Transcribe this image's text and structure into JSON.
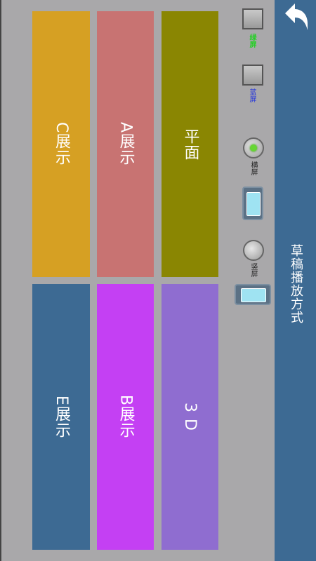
{
  "sidebar": {
    "title": "草稿播放方式",
    "back_icon": "back-arrow-icon",
    "color": "#3d6a93"
  },
  "tiles": {
    "c_display": {
      "label": "C展示",
      "color": "#d6a023"
    },
    "a_display": {
      "label": "A展示",
      "color": "#c87372"
    },
    "flat": {
      "label": "平面",
      "color": "#8a8602"
    },
    "e_display": {
      "label": "E展示",
      "color": "#3d6a93"
    },
    "b_display": {
      "label": "B展示",
      "color": "#c440f3"
    },
    "three_d": {
      "label": "3 D",
      "color": "#8f6dd0"
    }
  },
  "options": {
    "green_screen": {
      "label": "绿屏",
      "color": "#22d022",
      "checked": false
    },
    "blue_screen": {
      "label": "蓝屏",
      "color": "#2233dd",
      "checked": false
    },
    "landscape": {
      "label": "横屏",
      "selected": true
    },
    "portrait": {
      "label": "竖屏",
      "selected": false
    }
  }
}
